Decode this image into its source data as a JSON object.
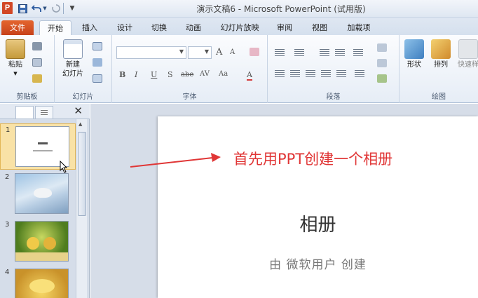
{
  "titlebar": {
    "app_icon": "P",
    "title": "演示文稿6 - Microsoft PowerPoint (试用版)",
    "qat": [
      "save-icon",
      "undo-icon",
      "redo-icon",
      "customize-icon"
    ]
  },
  "tabs": [
    {
      "label": "文件"
    },
    {
      "label": "开始"
    },
    {
      "label": "插入"
    },
    {
      "label": "设计"
    },
    {
      "label": "切换"
    },
    {
      "label": "动画"
    },
    {
      "label": "幻灯片放映"
    },
    {
      "label": "审阅"
    },
    {
      "label": "视图"
    },
    {
      "label": "加载项"
    }
  ],
  "ribbon": {
    "clipboard": {
      "paste": "粘贴",
      "label": "剪贴板"
    },
    "slides": {
      "new_slide_1": "新建",
      "new_slide_2": "幻灯片",
      "label": "幻灯片"
    },
    "font": {
      "label": "字体",
      "font_size_up": "A",
      "font_size_down": "A",
      "bold": "B",
      "italic": "I",
      "underline": "U",
      "strike": "S",
      "shadow": "abe",
      "spacing": "AV",
      "case": "Aa",
      "color": "A"
    },
    "paragraph": {
      "label": "段落"
    },
    "drawing": {
      "shapes": "形状",
      "arrange": "排列",
      "quick_styles": "快速样",
      "label": "绘图"
    }
  },
  "slides_pane": {
    "slides": [
      {
        "num": "1"
      },
      {
        "num": "2"
      },
      {
        "num": "3"
      },
      {
        "num": "4"
      }
    ]
  },
  "slide": {
    "title": "相册",
    "subtitle": "由 微软用户 创建"
  },
  "annotation": "首先用PPT创建一个相册"
}
